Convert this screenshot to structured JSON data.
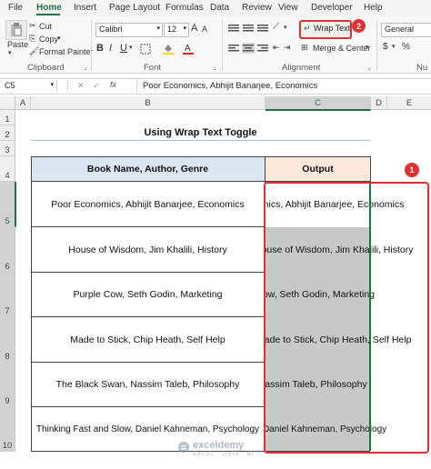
{
  "menu": {
    "items": [
      "File",
      "Home",
      "Insert",
      "Page Layout",
      "Formulas",
      "Data",
      "Review",
      "View",
      "Developer",
      "Help"
    ],
    "active": "Home"
  },
  "ribbon": {
    "clipboard": {
      "paste": "Paste",
      "cut": "Cut",
      "copy": "Copy",
      "format_painter": "Format Painter",
      "label": "Clipboard"
    },
    "font": {
      "name": "Calibri",
      "size": "12",
      "grow": "A",
      "shrink": "A",
      "bold": "B",
      "italic": "I",
      "underline": "U",
      "label": "Font"
    },
    "alignment": {
      "wrap_text": "Wrap Text",
      "merge_center": "Merge & Center",
      "label": "Alignment"
    },
    "number": {
      "format": "General",
      "percent": "%",
      "label": "Nu"
    }
  },
  "formula_bar": {
    "name_box": "C5",
    "fx": "fx",
    "content": "Poor Economics, Abhijit Banarjee, Economics"
  },
  "sheet": {
    "columns": [
      "A",
      "B",
      "C",
      "D",
      "E"
    ],
    "rows": [
      "1",
      "2",
      "3",
      "4",
      "5",
      "6",
      "7",
      "8",
      "9",
      "10"
    ],
    "title": "Using Wrap Text Toggle",
    "header_b": "Book Name, Author, Genre",
    "header_c": "Output",
    "records": [
      {
        "book": "Poor Economics, Abhijit Banarjee, Economics",
        "output": "Economics, Abhijit Banarjee, Economics"
      },
      {
        "book": "House of Wisdom, Jim Khalili, History",
        "output": "House of Wisdom, Jim Khalili, History"
      },
      {
        "book": "Purple Cow, Seth Godin, Marketing",
        "output": "Purple Cow, Seth Godin, Marketing"
      },
      {
        "book": "Made to Stick, Chip Heath, Self Help",
        "output": "Made to Stick, Chip Heath, Self Help"
      },
      {
        "book": "The Black Swan, Nassim Taleb, Philosophy",
        "output": "The Black Swan, Nassim Taleb, Philosophy"
      },
      {
        "book": "Thinking Fast and Slow, Daniel Kahneman, Psychology",
        "output": "Thinking Fast and Slow, Daniel Kahneman, Psychology"
      }
    ]
  },
  "annotations": {
    "badge_1": "1",
    "badge_2": "2"
  },
  "watermark": {
    "name": "exceldemy",
    "tagline": "EXCEL · DATA · BI"
  },
  "colors": {
    "accent": "#1e7145",
    "highlight": "#e03030",
    "header_fill": "#fde9d9",
    "selected_fill": "#c8c8c8",
    "row_header_selected": "#d2d2d2"
  }
}
